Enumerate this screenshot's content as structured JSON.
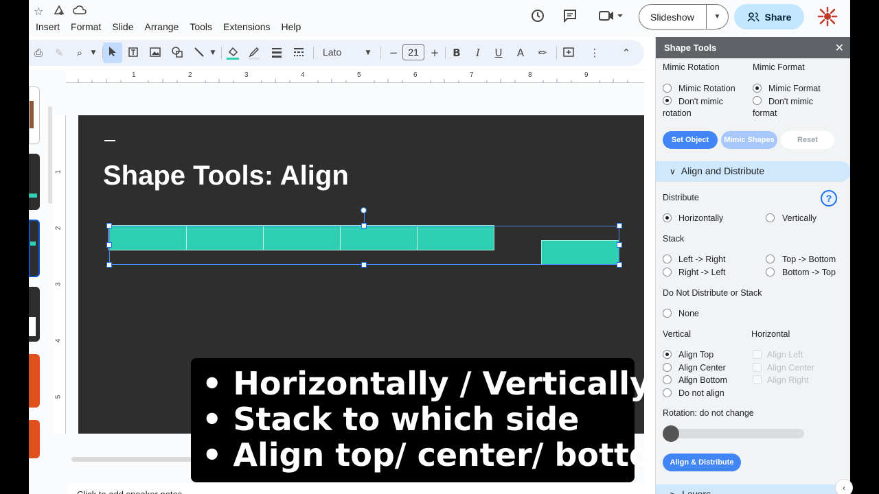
{
  "menu": [
    "Insert",
    "Format",
    "Slide",
    "Arrange",
    "Tools",
    "Extensions",
    "Help"
  ],
  "header": {
    "slideshow_label": "Slideshow",
    "share_label": "Share"
  },
  "toolbar": {
    "font_name": "Lato",
    "font_size": "21"
  },
  "ruler": {
    "h_ticks": [
      "1",
      "2",
      "3",
      "4",
      "5",
      "6",
      "7",
      "8",
      "9"
    ],
    "v_ticks": [
      "1",
      "2",
      "3",
      "4",
      "5"
    ]
  },
  "slide": {
    "title": "Shape Tools: Align"
  },
  "notes": {
    "placeholder": "Click to add speaker notes"
  },
  "caption": {
    "lines": [
      "• Horizontally / Vertically",
      "• Stack to which side",
      "•  Align top/ center/ bottom"
    ]
  },
  "panel": {
    "title": "Shape Tools",
    "mimic_rotation": {
      "heading": "Mimic Rotation",
      "options": [
        "Mimic Rotation",
        "Don't mimic rotation"
      ],
      "selected": 1
    },
    "mimic_format": {
      "heading": "Mimic Format",
      "options": [
        "Mimic Format",
        "Don't mimic format"
      ],
      "selected": 0
    },
    "buttons": {
      "set_object": "Set Object",
      "mimic_shapes": "Mimic Shapes",
      "reset": "Reset"
    },
    "section_align": "Align and Distribute",
    "distribute": {
      "heading": "Distribute",
      "options": [
        "Horizontally",
        "Vertically"
      ],
      "selected": 0
    },
    "stack": {
      "heading": "Stack",
      "options": [
        "Left -> Right",
        "Top -> Bottom",
        "Right -> Left",
        "Bottom -> Top"
      ]
    },
    "no_distribute": {
      "heading": "Do Not Distribute or Stack",
      "option": "None"
    },
    "vertical": {
      "heading": "Vertical",
      "options": [
        "Align Top",
        "Align Center",
        "Align Bottom",
        "Do not align"
      ],
      "selected": 0
    },
    "horizontal": {
      "heading": "Horizontal",
      "options": [
        "Align Left",
        "Align Center",
        "Align Right"
      ]
    },
    "rotation_label": "Rotation: do not change",
    "rotation_value": 0,
    "align_button": "Align & Distribute",
    "section_layers": "Layers"
  },
  "colors": {
    "accent_blue": "#4285f4",
    "shape_teal": "#2ecfb2",
    "slide_bg": "#2e2e2e",
    "share_bg": "#c2e7ff"
  }
}
